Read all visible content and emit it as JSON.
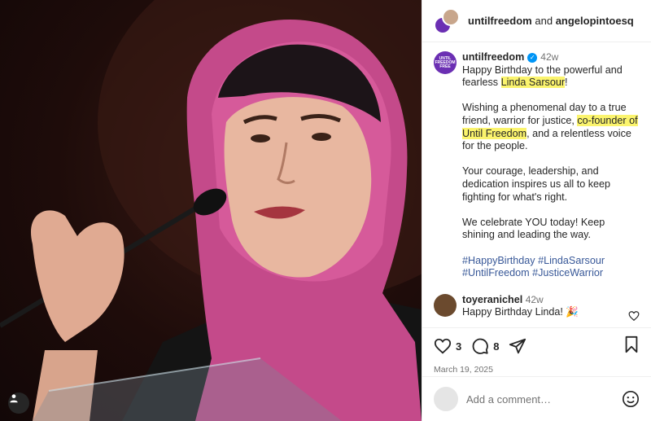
{
  "photo": {
    "alt_icon": "user-tag-icon"
  },
  "header": {
    "user1": "untilfreedom",
    "and": "and",
    "user2": "angelopintoesq"
  },
  "caption": {
    "avatar_text": "UNTIL FREEDOM FREE",
    "username": "untilfreedom",
    "verified_icon": "verified-badge-icon",
    "time": "42w",
    "p1_a": "Happy Birthday to the powerful and fearless ",
    "p1_hl": "Linda Sarsour",
    "p1_b": "!",
    "p2_a": "Wishing a phenomenal day to a true friend, warrior for justice, ",
    "p2_hl": "co-founder of Until Freedom",
    "p2_b": ", and a relentless voice for the people.",
    "p3": "Your courage, leadership, and dedication inspires us all to keep fighting for what's right.",
    "p4": "We celebrate YOU today! Keep shining and leading the way.",
    "tags": [
      "#HappyBirthday",
      "#LindaSarsour",
      "#UntilFreedom",
      "#JusticeWarrior"
    ]
  },
  "comment": {
    "username": "toyeranichel",
    "time": "42w",
    "text": "Happy Birthday Linda! 🎉"
  },
  "actions": {
    "likes": "3",
    "comments": "8",
    "date": "March 19, 2025"
  },
  "comment_bar": {
    "placeholder": "Add a comment…"
  },
  "colors": {
    "highlight": "#fbf46d",
    "hashtag": "#385898",
    "verified": "#0095f6",
    "muted": "#737373"
  }
}
